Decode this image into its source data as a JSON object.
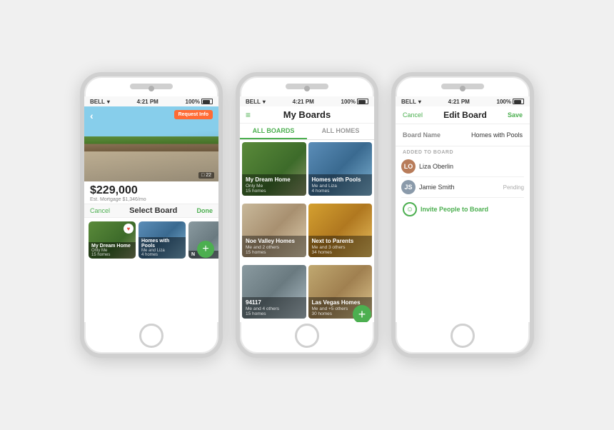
{
  "phones": {
    "phone1": {
      "statusBar": {
        "carrier": "BELL",
        "time": "4:21 PM",
        "battery": "100%"
      },
      "backBtn": "‹",
      "requestBtn": "Request Info",
      "photoCount": "□ 22",
      "price": "$229,000",
      "mortgage": "Est. Mortgage $1,346/mo",
      "header": {
        "cancel": "Cancel",
        "title": "Select Board",
        "done": "Done"
      },
      "boards": [
        {
          "name": "My Dream Home",
          "sub": "Only Me",
          "homes": "15 homes",
          "bg": "green",
          "heart": true
        },
        {
          "name": "Homes with Pools",
          "sub": "Me and Liza",
          "homes": "4 homes",
          "bg": "pool",
          "heart": false
        },
        {
          "name": "N",
          "sub": "",
          "homes": "",
          "bg": "urban",
          "heart": false
        }
      ],
      "addBtn": "+"
    },
    "phone2": {
      "statusBar": {
        "carrier": "BELL",
        "time": "4:21 PM",
        "battery": "100%"
      },
      "title": "My Boards",
      "tabs": [
        {
          "label": "ALL BOARDS",
          "active": true
        },
        {
          "label": "ALL HOMES",
          "active": false
        }
      ],
      "boards": [
        {
          "name": "My Dream Home",
          "sub": "Only Me",
          "homes": "15 homes",
          "bg": "green"
        },
        {
          "name": "Homes with Pools",
          "sub": "Me and Liza",
          "homes": "4 homes",
          "bg": "pool"
        },
        {
          "name": "Noe Valley Homes",
          "sub": "Me and 2 others",
          "homes": "15 homes",
          "bg": "kitchen"
        },
        {
          "name": "Next to Parents",
          "sub": "Me and 3 others",
          "homes": "34 homes",
          "bg": "autumn"
        },
        {
          "name": "94117",
          "sub": "Me and 4 others",
          "homes": "15 homes",
          "bg": "urban"
        },
        {
          "name": "Las Vegas Homes",
          "sub": "Me and +5 others",
          "homes": "30 homes",
          "bg": "vegas"
        }
      ],
      "addBtn": "+"
    },
    "phone3": {
      "statusBar": {
        "carrier": "BELL",
        "time": "4:21 PM",
        "battery": "100%"
      },
      "cancelBtn": "Cancel",
      "title": "Edit Board",
      "saveBtn": "Save",
      "fieldLabel": "Board Name",
      "fieldValue": "Homes with Pools",
      "addedLabel": "ADDED TO BOARD",
      "members": [
        {
          "initials": "LO",
          "name": "Liza Oberlin",
          "status": "",
          "color": "#b87c5a"
        },
        {
          "initials": "JS",
          "name": "Jamie Smith",
          "status": "Pending",
          "color": "#8a9aaa"
        }
      ],
      "inviteText": "Invite People to Board"
    }
  }
}
